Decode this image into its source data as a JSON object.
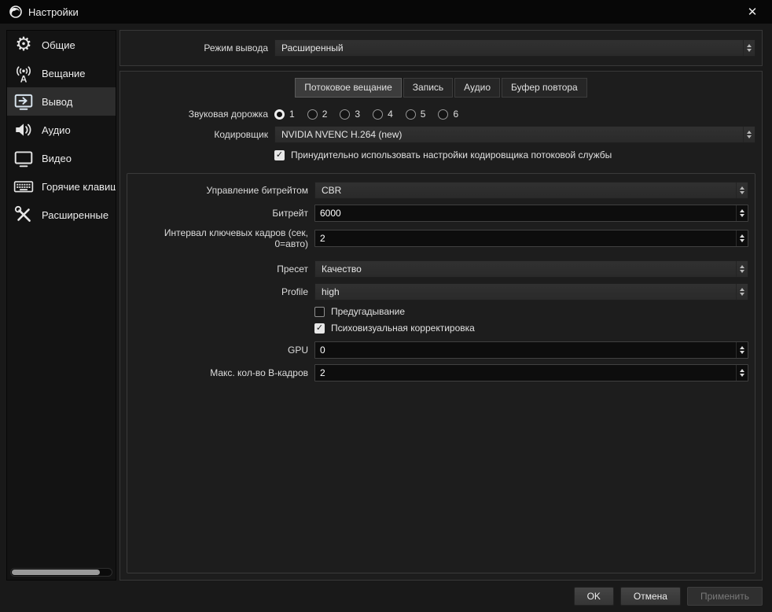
{
  "window": {
    "title": "Настройки",
    "close_glyph": "✕"
  },
  "icons": {
    "check": "✓",
    "gear": "⚙"
  },
  "sidebar": {
    "items": [
      {
        "label": "Общие"
      },
      {
        "label": "Вещание"
      },
      {
        "label": "Вывод"
      },
      {
        "label": "Аудио"
      },
      {
        "label": "Видео"
      },
      {
        "label": "Горячие клавиши"
      },
      {
        "label": "Расширенные"
      }
    ],
    "selected": "Вывод"
  },
  "output_mode": {
    "label": "Режим вывода",
    "value": "Расширенный"
  },
  "tabs": {
    "items": [
      {
        "label": "Потоковое вещание"
      },
      {
        "label": "Запись"
      },
      {
        "label": "Аудио"
      },
      {
        "label": "Буфер повтора"
      }
    ],
    "selected": "Потоковое вещание"
  },
  "stream": {
    "audio_track_label": "Звуковая дорожка",
    "audio_tracks": [
      "1",
      "2",
      "3",
      "4",
      "5",
      "6"
    ],
    "audio_track_selected": "1",
    "encoder_label": "Кодировщик",
    "encoder_value": "NVIDIA NVENC H.264 (new)",
    "enforce_label": "Принудительно использовать настройки кодировщика потоковой службы",
    "enforce_checked": true,
    "rate_control_label": "Управление битрейтом",
    "rate_control_value": "CBR",
    "bitrate_label": "Битрейт",
    "bitrate_value": "6000",
    "keyint_label": "Интервал ключевых кадров (сек, 0=авто)",
    "keyint_value": "2",
    "preset_label": "Пресет",
    "preset_value": "Качество",
    "profile_label": "Profile",
    "profile_value": "high",
    "lookahead_label": "Предугадывание",
    "lookahead_checked": false,
    "psycho_label": "Психовизуальная корректировка",
    "psycho_checked": true,
    "gpu_label": "GPU",
    "gpu_value": "0",
    "bframes_label": "Макс. кол-во B-кадров",
    "bframes_value": "2"
  },
  "footer": {
    "ok": "OK",
    "cancel": "Отмена",
    "apply": "Применить"
  }
}
